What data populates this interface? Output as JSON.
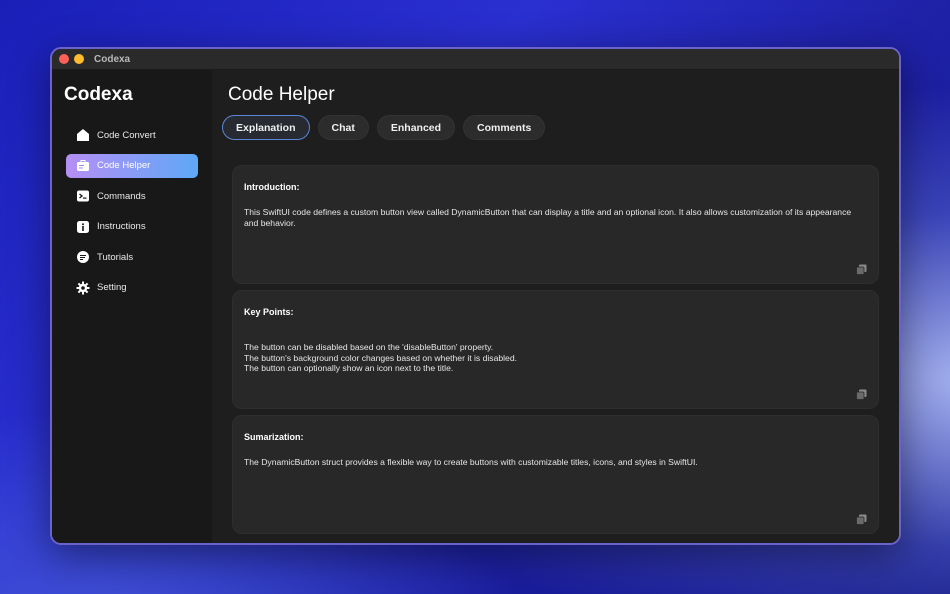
{
  "window": {
    "title": "Codexa"
  },
  "sidebar": {
    "brand": "Codexa",
    "items": [
      {
        "label": "Code Convert",
        "icon": "home-icon",
        "active": false
      },
      {
        "label": "Code Helper",
        "icon": "briefcase-icon",
        "active": true
      },
      {
        "label": "Commands",
        "icon": "terminal-icon",
        "active": false
      },
      {
        "label": "Instructions",
        "icon": "info-icon",
        "active": false
      },
      {
        "label": "Tutorials",
        "icon": "tutorial-icon",
        "active": false
      },
      {
        "label": "Setting",
        "icon": "gear-icon",
        "active": false
      }
    ]
  },
  "main": {
    "title": "Code Helper",
    "tabs": [
      {
        "label": "Explanation",
        "active": true
      },
      {
        "label": "Chat",
        "active": false
      },
      {
        "label": "Enhanced",
        "active": false
      },
      {
        "label": "Comments",
        "active": false
      }
    ],
    "cards": [
      {
        "title": "Introduction:",
        "text": "This SwiftUI code defines a custom button view called DynamicButton that can display a title and an optional icon. It also allows customization of its appearance and behavior."
      },
      {
        "title": "Key Points:",
        "text": "The button can be disabled based on the 'disableButton' property.\nThe button's background color changes based on whether it is disabled.\nThe button can optionally show an icon next to the title."
      },
      {
        "title": "Sumarization:",
        "text": "The DynamicButton struct provides a flexible way to create buttons with customizable titles, icons, and styles in SwiftUI."
      }
    ]
  },
  "colors": {
    "accent_start": "#b58ff5",
    "accent_end": "#5ea8f7",
    "close": "#fe5f57",
    "minimize": "#febc2e"
  }
}
